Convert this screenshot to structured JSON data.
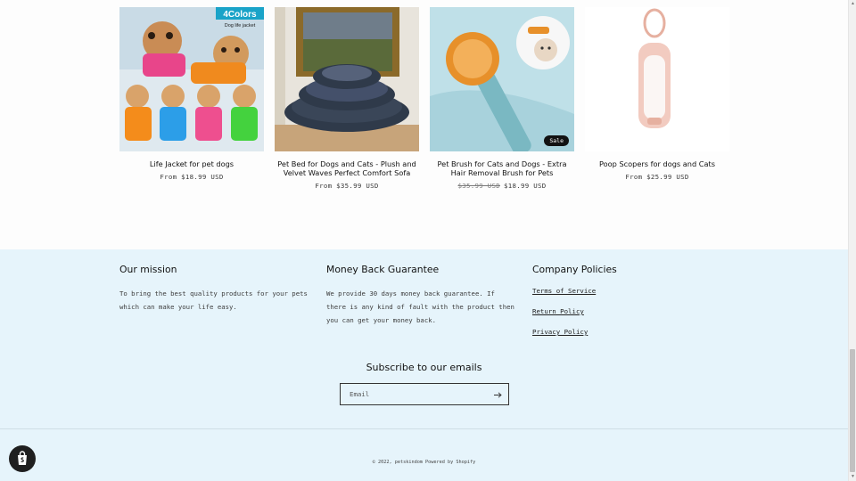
{
  "products": [
    {
      "title": "Life Jacket for pet dogs",
      "price": "From $18.99 USD",
      "compare_price": "",
      "badge": "",
      "image_text_1": "4Colors",
      "image_text_2": "Dog life jacket"
    },
    {
      "title": "Pet Bed for Dogs and Cats - Plush and Velvet Waves Perfect Comfort Sofa",
      "price": "From $35.99 USD",
      "compare_price": "",
      "badge": ""
    },
    {
      "title": "Pet Brush for Cats and Dogs - Extra Hair Removal Brush for Pets",
      "price": "$18.99 USD",
      "compare_price": "$35.99 USD",
      "badge": "Sale"
    },
    {
      "title": "Poop Scopers for dogs and Cats",
      "price": "From $25.99 USD",
      "compare_price": "",
      "badge": ""
    }
  ],
  "footer": {
    "mission": {
      "heading": "Our mission",
      "text": "To bring the best quality products for your pets which can make your life easy."
    },
    "guarantee": {
      "heading": "Money Back Guarantee",
      "text": "We provide 30 days money back guarantee. If there is any kind of fault with the product then you can get your money back."
    },
    "policies": {
      "heading": "Company Policies",
      "links": [
        "Terms of Service",
        "Return Policy",
        "Privacy Policy"
      ]
    },
    "subscribe": {
      "heading": "Subscribe to our emails",
      "placeholder": "Email"
    },
    "copyright": "© 2022, petskindom Powered by Shopify"
  },
  "colors": {
    "footer_bg": "#e6f4fb",
    "badge_bg": "#121212",
    "accent_blue": "#1aa3c8"
  },
  "icons": {
    "submit": "arrow-right-icon",
    "shop": "shopify-bag-icon"
  }
}
